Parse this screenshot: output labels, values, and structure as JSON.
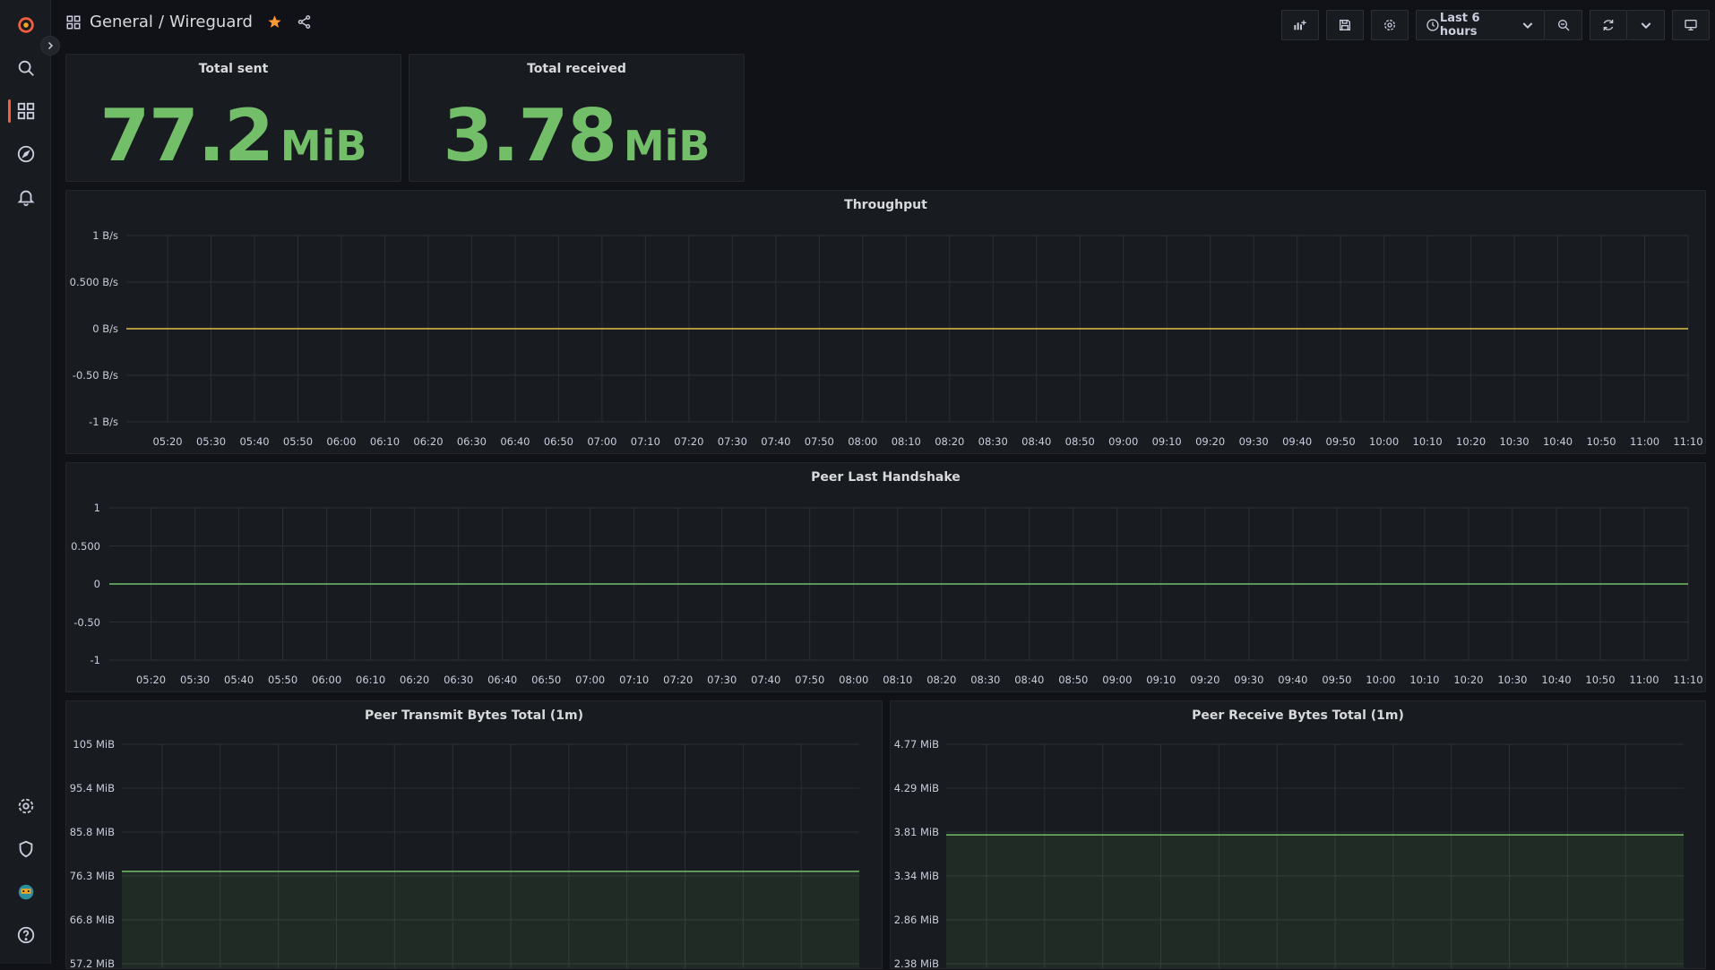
{
  "breadcrumb": {
    "folder": "General",
    "separator": "/",
    "dashboard": "Wireguard"
  },
  "toolbar": {
    "time_range": "Last 6 hours"
  },
  "stats": [
    {
      "title": "Total sent",
      "value": "77.2",
      "unit": "MiB"
    },
    {
      "title": "Total received",
      "value": "3.78",
      "unit": "MiB"
    }
  ],
  "colors": {
    "accent": "#f55f3e",
    "stat_green": "#73bf69",
    "series_yellow": "#e0c24a",
    "series_green": "#73bf69",
    "star": "#ff9830"
  },
  "chart_data": [
    {
      "type": "line",
      "title": "Throughput",
      "y_ticks": [
        "1 B/s",
        "0.500 B/s",
        "0 B/s",
        "-0.50 B/s",
        "-1 B/s"
      ],
      "ylim": [
        -1,
        1
      ],
      "x_ticks": [
        "05:20",
        "05:30",
        "05:40",
        "05:50",
        "06:00",
        "06:10",
        "06:20",
        "06:30",
        "06:40",
        "06:50",
        "07:00",
        "07:10",
        "07:20",
        "07:30",
        "07:40",
        "07:50",
        "08:00",
        "08:10",
        "08:20",
        "08:30",
        "08:40",
        "08:50",
        "09:00",
        "09:10",
        "09:20",
        "09:30",
        "09:40",
        "09:50",
        "10:00",
        "10:10",
        "10:20",
        "10:30",
        "10:40",
        "10:50",
        "11:00",
        "11:10"
      ],
      "series": [
        {
          "values": [
            0,
            0
          ],
          "color": "#e0c24a"
        }
      ],
      "grid": true
    },
    {
      "type": "line",
      "title": "Peer Last Handshake",
      "y_ticks": [
        "1",
        "0.500",
        "0",
        "-0.50",
        "-1"
      ],
      "ylim": [
        -1,
        1
      ],
      "x_ticks": [
        "05:20",
        "05:30",
        "05:40",
        "05:50",
        "06:00",
        "06:10",
        "06:20",
        "06:30",
        "06:40",
        "06:50",
        "07:00",
        "07:10",
        "07:20",
        "07:30",
        "07:40",
        "07:50",
        "08:00",
        "08:10",
        "08:20",
        "08:30",
        "08:40",
        "08:50",
        "09:00",
        "09:10",
        "09:20",
        "09:30",
        "09:40",
        "09:50",
        "10:00",
        "10:10",
        "10:20",
        "10:30",
        "10:40",
        "10:50",
        "11:00",
        "11:10"
      ],
      "series": [
        {
          "values": [
            0,
            0
          ],
          "color": "#73bf69"
        }
      ],
      "grid": true
    },
    {
      "type": "area",
      "title": "Peer Transmit Bytes Total (1m)",
      "y_ticks": [
        "105 MiB",
        "95.4 MiB",
        "85.8 MiB",
        "76.3 MiB",
        "66.8 MiB",
        "57.2 MiB"
      ],
      "y_tick_values": [
        105,
        95.4,
        85.8,
        76.3,
        66.8,
        57.2
      ],
      "series": [
        {
          "values": [
            77.2,
            77.2
          ],
          "color": "#73bf69"
        }
      ],
      "grid": true
    },
    {
      "type": "area",
      "title": "Peer Receive Bytes Total (1m)",
      "y_ticks": [
        "4.77 MiB",
        "4.29 MiB",
        "3.81 MiB",
        "3.34 MiB",
        "2.86 MiB",
        "2.38 MiB"
      ],
      "y_tick_values": [
        4.77,
        4.29,
        3.81,
        3.34,
        2.86,
        2.38
      ],
      "series": [
        {
          "values": [
            3.78,
            3.78
          ],
          "color": "#73bf69"
        }
      ],
      "grid": true
    }
  ]
}
